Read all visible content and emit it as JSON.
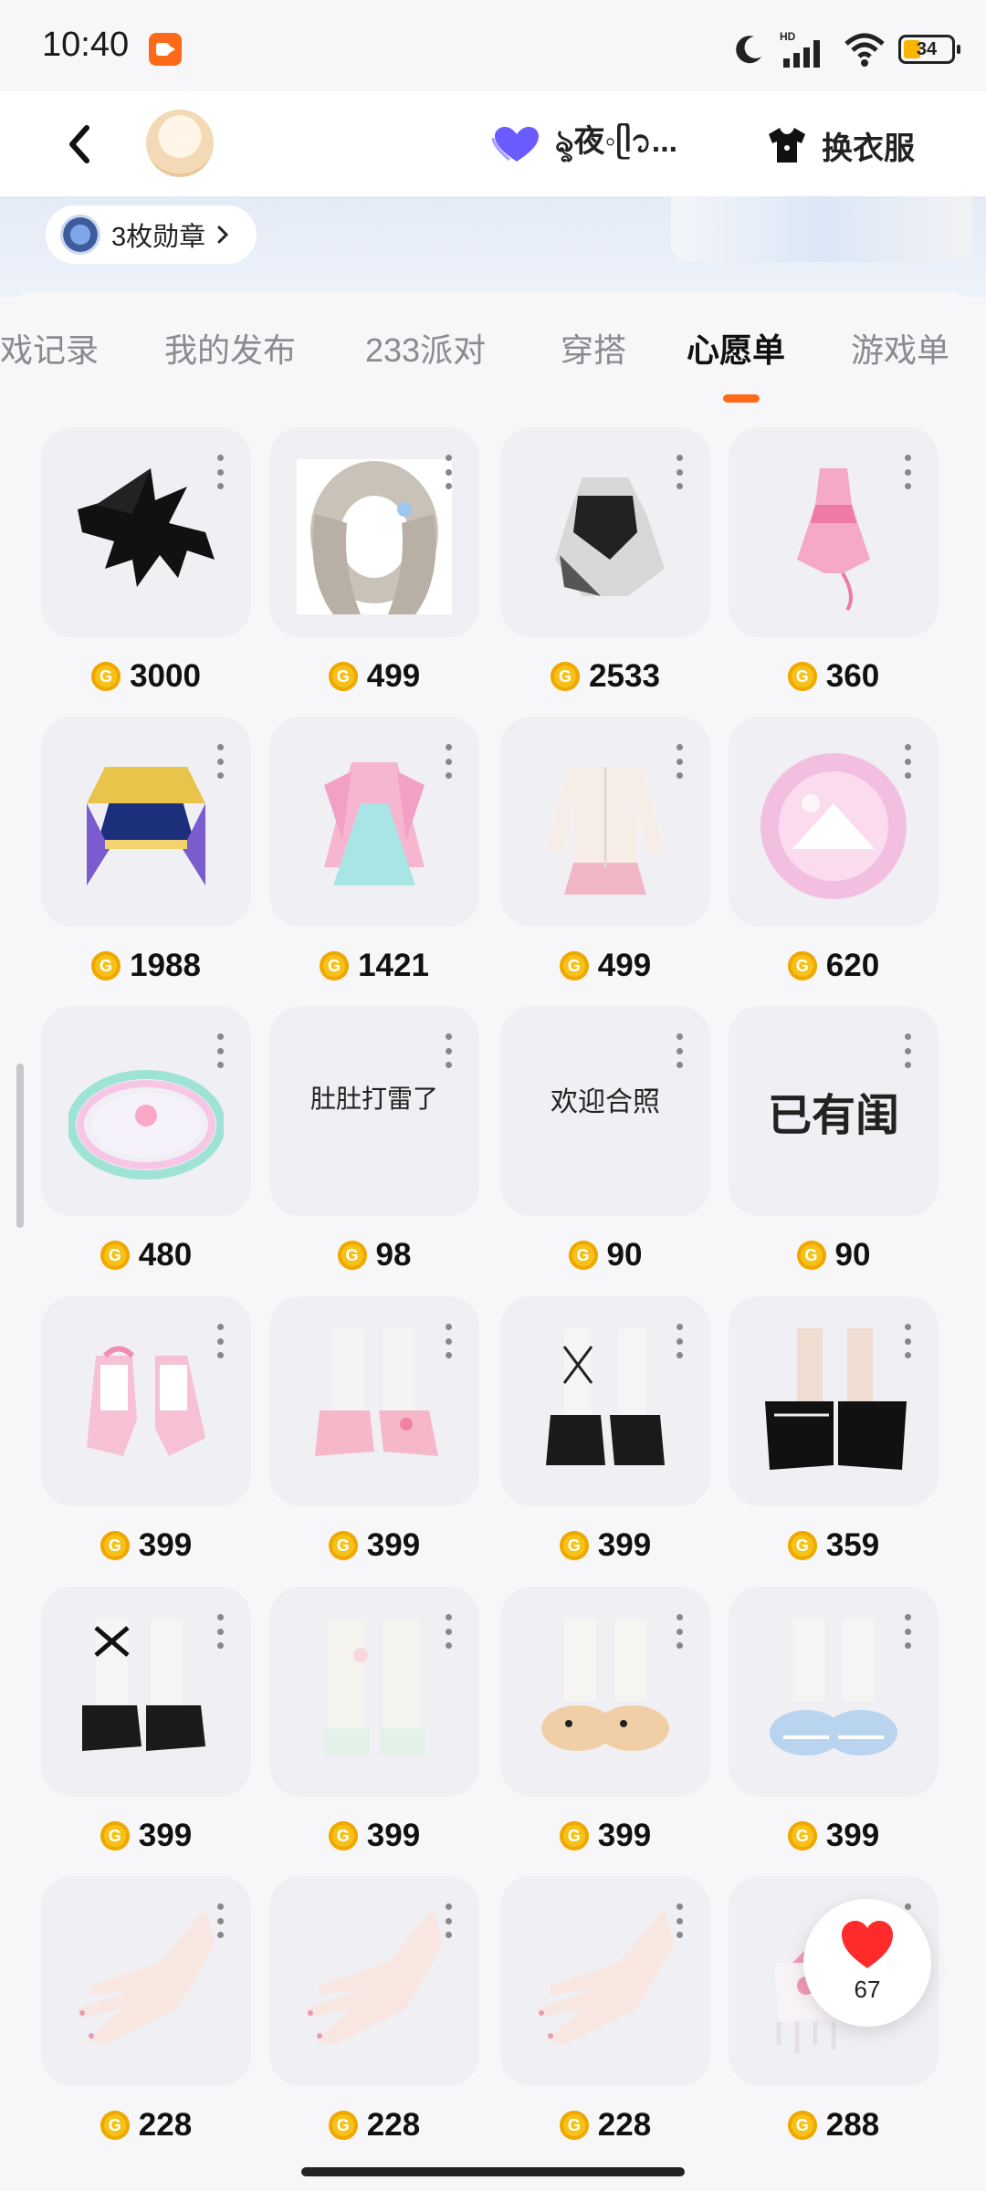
{
  "status_bar": {
    "time": "10:40",
    "network_label": "HD",
    "battery": "34"
  },
  "header": {
    "username": "ৡ夜◦ᥫ᭡...",
    "outfit_label": "换衣服"
  },
  "banner": {
    "badge_text": "3枚勋章"
  },
  "tabs": [
    "戏记录",
    "我的发布",
    "233派对",
    "穿搭",
    "心愿单",
    "游戏单"
  ],
  "active_tab": "心愿单",
  "items": [
    {
      "price": "3000",
      "kind": "dragon"
    },
    {
      "price": "499",
      "kind": "hair"
    },
    {
      "price": "2533",
      "kind": "dark-dress"
    },
    {
      "price": "360",
      "kind": "pink-dress"
    },
    {
      "price": "1988",
      "kind": "crown-dress"
    },
    {
      "price": "1421",
      "kind": "pastel-dress"
    },
    {
      "price": "499",
      "kind": "cardigan"
    },
    {
      "price": "620",
      "kind": "pink-bubble"
    },
    {
      "price": "480",
      "kind": "rainbow-ring"
    },
    {
      "price": "98",
      "kind": "sticker",
      "text": "肚肚打雷了"
    },
    {
      "price": "90",
      "kind": "sticker",
      "text": "欢迎合照"
    },
    {
      "price": "90",
      "kind": "sticker",
      "text": "已有闺"
    },
    {
      "price": "399",
      "kind": "pink-shoes"
    },
    {
      "price": "399",
      "kind": "pink-loafers"
    },
    {
      "price": "399",
      "kind": "black-lace"
    },
    {
      "price": "359",
      "kind": "black-platform"
    },
    {
      "price": "399",
      "kind": "black-ribbon"
    },
    {
      "price": "399",
      "kind": "white-socks"
    },
    {
      "price": "399",
      "kind": "cat-slippers"
    },
    {
      "price": "399",
      "kind": "shark-slippers"
    },
    {
      "price": "228",
      "kind": "hand"
    },
    {
      "price": "228",
      "kind": "hand"
    },
    {
      "price": "228",
      "kind": "hand"
    },
    {
      "price": "288",
      "kind": "pink-accessory"
    }
  ],
  "like": {
    "count": "67"
  },
  "colors": {
    "accent": "#ff6a1a",
    "coin": "#f6c21a",
    "heart": "#ff2a2a",
    "vip": "#6a5cff"
  }
}
